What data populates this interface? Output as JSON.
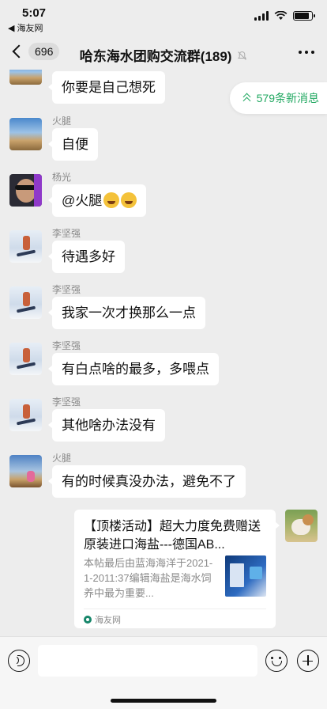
{
  "status_bar": {
    "time": "5:07",
    "back_app": "◀ 海友网",
    "battery_level": 0.85
  },
  "nav": {
    "back_count": "696",
    "title": "哈东海水团购交流群(189)",
    "mute_icon": "mute-bell-icon",
    "more_icon": "more-dots-icon"
  },
  "new_messages": {
    "label": "579条新消息",
    "icon": "double-chevron-up-icon",
    "color": "#21a861"
  },
  "messages": [
    {
      "sender": "",
      "text": "你要是自己想死",
      "avatar": "sunset-field"
    },
    {
      "sender": "火腿",
      "text": "自便",
      "avatar": "sunset-field"
    },
    {
      "sender": "杨光",
      "text": "@火腿",
      "emojis": [
        "laugh-cry-emoji",
        "laugh-cry-emoji"
      ],
      "avatar": "sunglasses-face"
    },
    {
      "sender": "李坚强",
      "text": "待遇多好",
      "avatar": "snowboarder"
    },
    {
      "sender": "李坚强",
      "text": "我家一次才换那么一点",
      "avatar": "snowboarder"
    },
    {
      "sender": "李坚强",
      "text": "有白点啥的最多，多喂点",
      "avatar": "snowboarder"
    },
    {
      "sender": "李坚强",
      "text": "其他啥办法没有",
      "avatar": "snowboarder"
    },
    {
      "sender": "火腿",
      "text": "有的时候真没办法，避免不了",
      "avatar": "sunset-field"
    }
  ],
  "link_card": {
    "title": "【顶楼活动】超大力度免费赠送原装进口海盐---德国AB...",
    "description": "本帖最后由蓝海海洋于2021-1-2011:37编辑海盐是海水饲养中最为重要...",
    "source": "海友网"
  },
  "input_bar": {
    "placeholder": "",
    "voice_icon": "voice-icon",
    "emoji_icon": "emoji-icon",
    "plus_icon": "plus-icon"
  },
  "colors": {
    "background": "#ededed",
    "bubble": "#ffffff",
    "accent_green": "#21a861"
  }
}
